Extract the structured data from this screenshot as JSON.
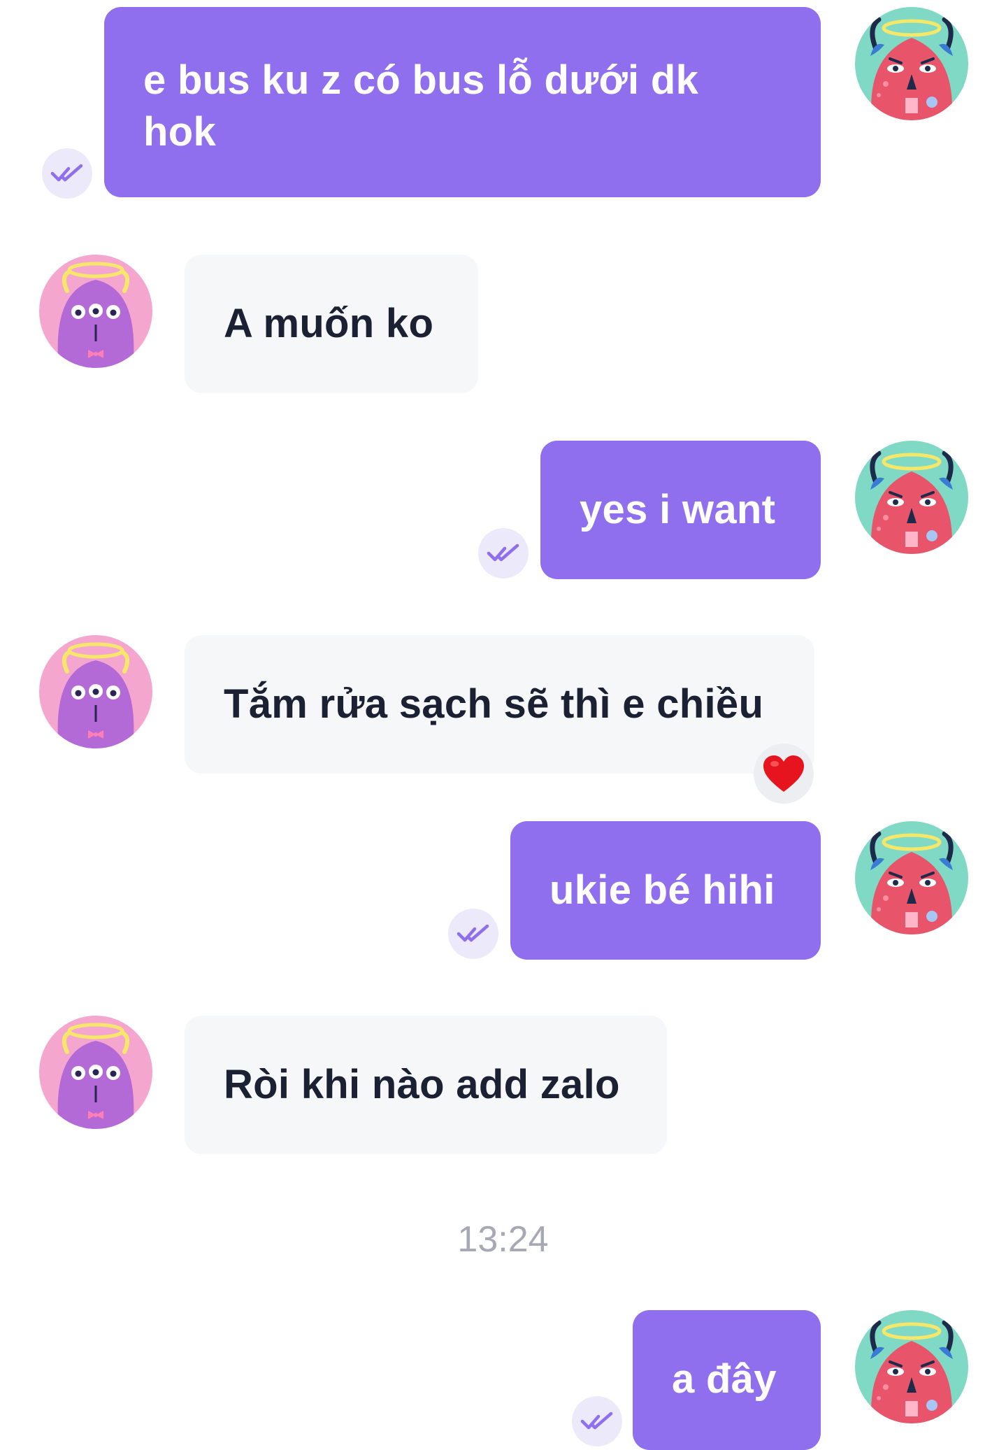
{
  "theme": {
    "outgoing_bubble": "#8f6fed",
    "incoming_bubble": "#f6f7f9",
    "incoming_text": "#1b2133",
    "outgoing_text": "#ffffff",
    "timestamp_text": "#a6a9b4",
    "read_badge": "#ece9fb",
    "read_check": "#8f6fed"
  },
  "messages": [
    {
      "direction": "outgoing",
      "text_lines": [
        "e bus ku z có bus lỗ dưới dk",
        "hok"
      ],
      "status_icon": "double-check-icon",
      "avatar": "red-monster-avatar"
    },
    {
      "direction": "incoming",
      "text": "A muốn ko",
      "avatar": "purple-monster-avatar"
    },
    {
      "direction": "outgoing",
      "text": "yes i want",
      "status_icon": "double-check-icon",
      "avatar": "red-monster-avatar"
    },
    {
      "direction": "incoming",
      "text": "Tắm rửa sạch sẽ thì e chiều",
      "reaction": "heart-reaction-icon",
      "avatar": "purple-monster-avatar"
    },
    {
      "direction": "outgoing",
      "text": "ukie bé hihi",
      "status_icon": "double-check-icon",
      "avatar": "red-monster-avatar"
    },
    {
      "direction": "incoming",
      "text": "Ròi khi nào add zalo",
      "avatar": "purple-monster-avatar"
    },
    {
      "direction": "outgoing",
      "text": "a đây",
      "status_icon": "double-check-icon",
      "avatar": "red-monster-avatar"
    }
  ],
  "separator": {
    "time": "13:24"
  }
}
